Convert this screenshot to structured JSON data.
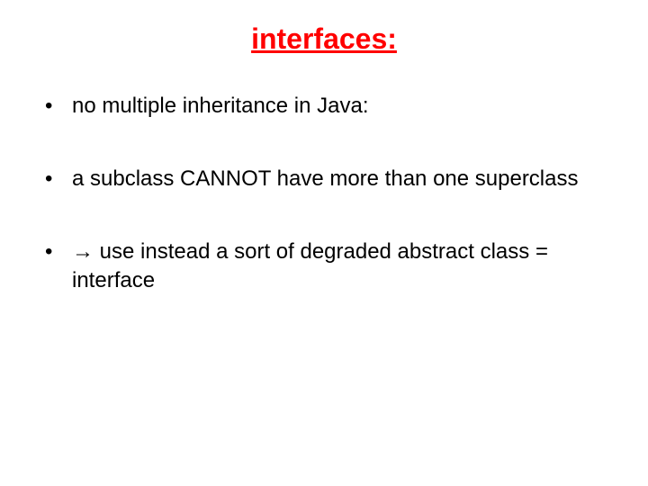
{
  "title": "interfaces:",
  "bullets": [
    "no multiple inheritance in Java:",
    "a subclass CANNOT have more than one superclass",
    "→ use instead a sort of degraded abstract class = interface"
  ]
}
